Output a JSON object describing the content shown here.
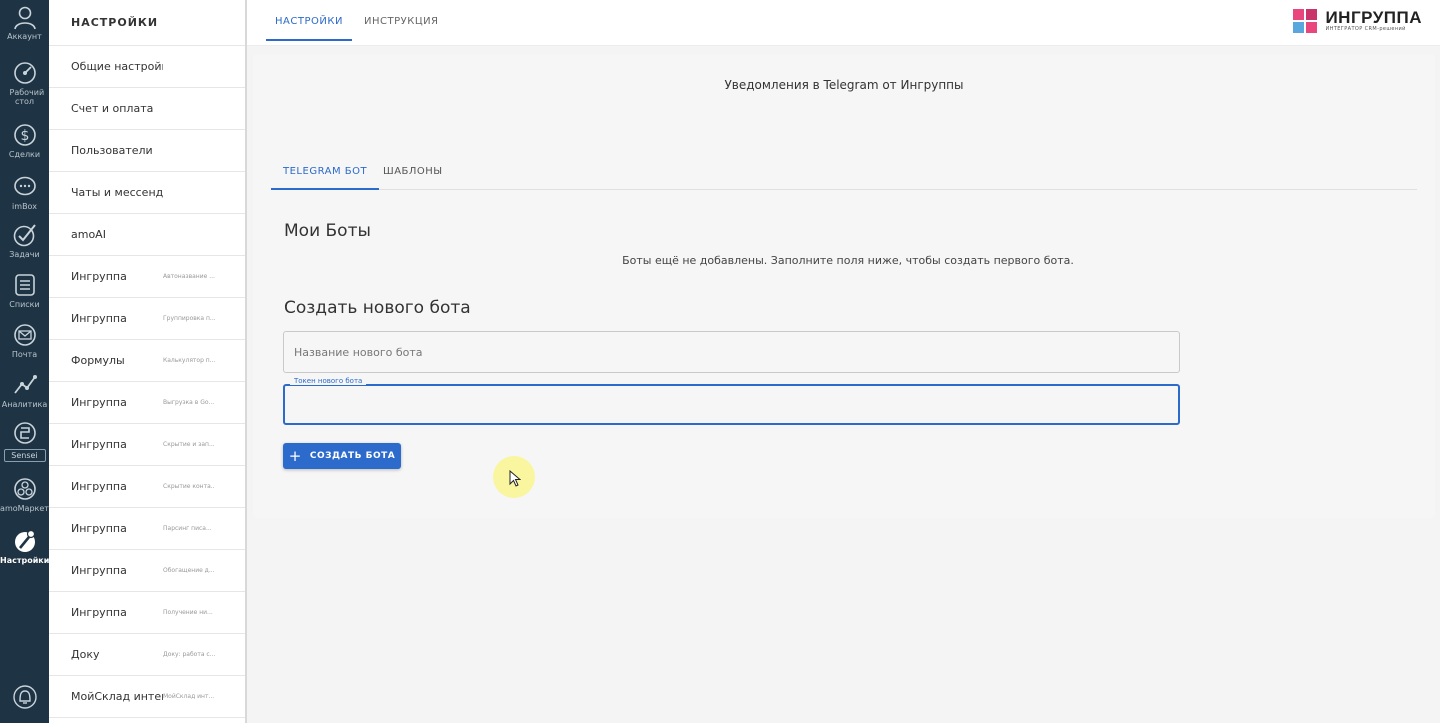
{
  "rail": {
    "items": [
      {
        "label": "Аккаунт",
        "icon": "account-icon"
      },
      {
        "label": "Рабочий стол",
        "icon": "dashboard-icon"
      },
      {
        "label": "Сделки",
        "icon": "dollar-icon"
      },
      {
        "label": "imBox",
        "icon": "chat-icon"
      },
      {
        "label": "Задачи",
        "icon": "check-icon"
      },
      {
        "label": "Списки",
        "icon": "list-icon"
      },
      {
        "label": "Почта",
        "icon": "mail-icon"
      },
      {
        "label": "Аналитика",
        "icon": "analytics-icon"
      },
      {
        "label": "Sensei",
        "icon": "sensei-icon"
      },
      {
        "label": "amoМаркет",
        "icon": "market-icon"
      },
      {
        "label": "Настройки",
        "icon": "settings-icon"
      }
    ]
  },
  "settings": {
    "title": "НАСТРОЙКИ",
    "items": [
      {
        "name": "Общие настройки",
        "desc": ""
      },
      {
        "name": "Счет и оплата",
        "desc": ""
      },
      {
        "name": "Пользователи",
        "desc": ""
      },
      {
        "name": "Чаты и мессенджеры",
        "desc": ""
      },
      {
        "name": "amoAI",
        "desc": ""
      },
      {
        "name": "Ингруппа",
        "desc": "Автоназвание ..."
      },
      {
        "name": "Ингруппа",
        "desc": "Группировка п..."
      },
      {
        "name": "Формулы",
        "desc": "Калькулятор п..."
      },
      {
        "name": "Ингруппа",
        "desc": "Выгрузка в Go..."
      },
      {
        "name": "Ингруппа",
        "desc": "Скрытие и зап..."
      },
      {
        "name": "Ингруппа",
        "desc": "Скрытие конта..."
      },
      {
        "name": "Ингруппа",
        "desc": "Парсинг писа..."
      },
      {
        "name": "Ингруппа",
        "desc": "Обогащение д..."
      },
      {
        "name": "Ингруппа",
        "desc": "Получение ни..."
      },
      {
        "name": "Доку",
        "desc": "Доку: работа с..."
      },
      {
        "name": "МойСклад интег...",
        "desc": "МойСклад инт..."
      }
    ]
  },
  "topbar": {
    "tabs": [
      {
        "label": "НАСТРОЙКИ",
        "active": true
      },
      {
        "label": "ИНСТРУКЦИЯ",
        "active": false
      }
    ],
    "brand_name": "ИНГРУППА",
    "brand_tagline": "ИНТЕГРАТОР CRM-решений",
    "brand_colors": [
      "#e8467c",
      "#c9356a",
      "#5aa7de",
      "#e8467c"
    ]
  },
  "main": {
    "header": "Уведомления в Telegram от Ингруппы",
    "tabs": [
      {
        "label": "TELEGRAM БОТ",
        "active": true
      },
      {
        "label": "ШАБЛОНЫ",
        "active": false
      }
    ],
    "my_bots_title": "Мои Боты",
    "empty_message": "Боты ещё не добавлены. Заполните поля ниже, чтобы создать первого бота.",
    "create_title": "Создать нового бота",
    "bot_name_placeholder": "Название нового бота",
    "bot_token_label": "Токен нового бота",
    "bot_token_value": "",
    "create_button": "СОЗДАТЬ БОТА"
  },
  "colors": {
    "accent": "#2c6acb",
    "rail": "#1e3343"
  }
}
